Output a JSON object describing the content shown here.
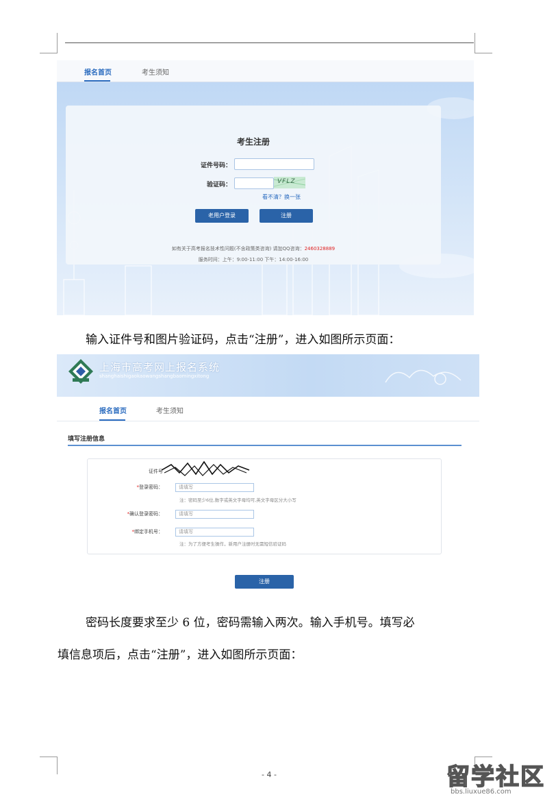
{
  "shot1": {
    "nav": {
      "tab_home": "报名首页",
      "tab_notice": "考生须知"
    },
    "title": "考生注册",
    "id_label": "证件号码：",
    "captcha_label": "验证码：",
    "captcha_text": "VFLZ",
    "refresh_link": "看不清？换一张",
    "old_user_button": "老用户登录",
    "register_button": "注册",
    "footnote_line1_prefix": "如有关于高考报名技术性问题(不含政策类咨询)    请加QQ咨询：",
    "footnote_qq": "2460328889",
    "footnote_line2": "服务时间：上午：9:00-11:00    下午：14:00-16:00"
  },
  "paragraph1": "输入证件号和图片验证码，点击“注册”，进入如图所示页面：",
  "shot2": {
    "site_title": "上海市高考网上报名系统",
    "site_subtitle": "shanghaishigaokaowangshangbaomingxitong",
    "nav": {
      "tab_home": "报名首页",
      "tab_notice": "考生须知"
    },
    "section_title": "填写注册信息",
    "fields": {
      "id_label": "证件号",
      "password_label": "登录密码：",
      "password_placeholder": "请填写",
      "password_hint": "注：密码至少6位,数字或英文字母均可,英文字母区分大小写",
      "confirm_label": "确认登录密码：",
      "confirm_placeholder": "请填写",
      "phone_label": "绑定手机号：",
      "phone_placeholder": "请填写",
      "phone_hint": "注：为了方便考生操作，新用户注册时无需短信验证码",
      "required_mark": "*"
    },
    "register_button": "注册"
  },
  "paragraph2_line1": "密码长度要求至少 6 位，密码需输入两次。输入手机号。填写必",
  "paragraph2_line2": "填信息项后，点击“注册”，进入如图所示页面：",
  "page_number": "- 4 -",
  "watermark": {
    "main": "留学社区",
    "sub": "bbs.liuxue86.com"
  }
}
